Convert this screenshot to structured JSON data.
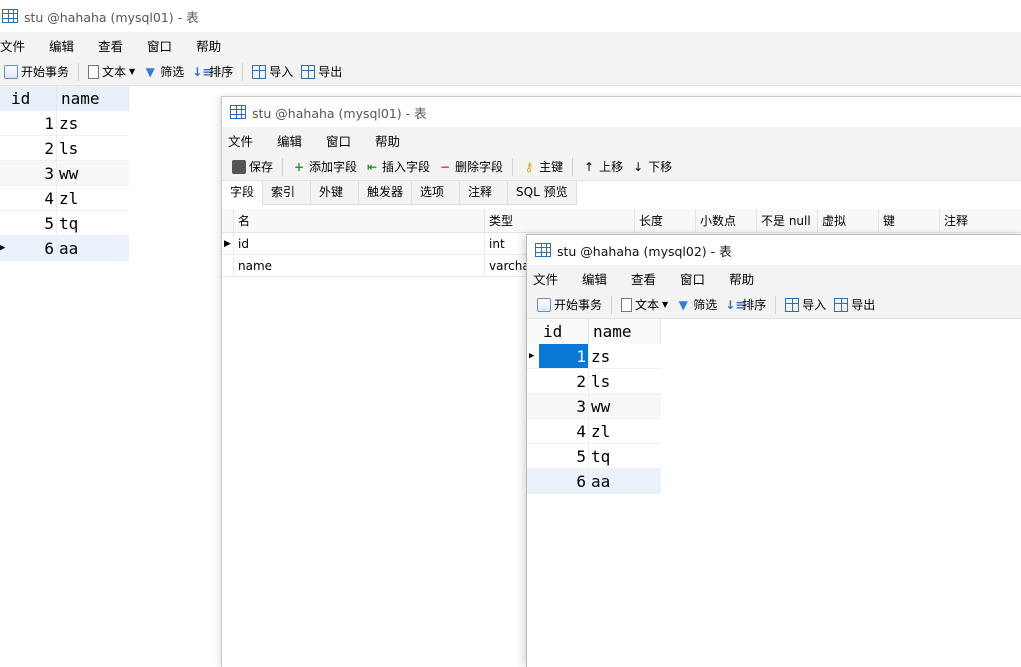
{
  "win1": {
    "title": "stu @hahaha (mysql01) - 表",
    "menu": [
      "文件",
      "编辑",
      "查看",
      "窗口",
      "帮助"
    ],
    "toolbar": {
      "begin_tx": "开始事务",
      "text": "文本",
      "filter": "筛选",
      "sort": "排序",
      "import": "导入",
      "export": "导出"
    },
    "grid": {
      "headers": [
        "id",
        "name"
      ],
      "rows": [
        {
          "id": "1",
          "name": "zs"
        },
        {
          "id": "2",
          "name": "ls"
        },
        {
          "id": "3",
          "name": "ww"
        },
        {
          "id": "4",
          "name": "zl"
        },
        {
          "id": "5",
          "name": "tq"
        },
        {
          "id": "6",
          "name": "aa"
        }
      ]
    }
  },
  "win2": {
    "title": "stu @hahaha (mysql01) - 表",
    "menu": [
      "文件",
      "编辑",
      "窗口",
      "帮助"
    ],
    "toolbar": {
      "save": "保存",
      "add_field": "添加字段",
      "insert_field": "插入字段",
      "delete_field": "删除字段",
      "primary_key": "主键",
      "move_up": "上移",
      "move_down": "下移"
    },
    "tabs": [
      "字段",
      "索引",
      "外键",
      "触发器",
      "选项",
      "注释",
      "SQL 预览"
    ],
    "fields": {
      "headers": [
        "名",
        "类型",
        "长度",
        "小数点",
        "不是 null",
        "虚拟",
        "键",
        "注释"
      ],
      "rows": [
        {
          "name": "id",
          "type": "int"
        },
        {
          "name": "name",
          "type": "varchar"
        }
      ]
    }
  },
  "win3": {
    "title": "stu @hahaha (mysql02) - 表",
    "menu": [
      "文件",
      "编辑",
      "查看",
      "窗口",
      "帮助"
    ],
    "toolbar": {
      "begin_tx": "开始事务",
      "text": "文本",
      "filter": "筛选",
      "sort": "排序",
      "import": "导入",
      "export": "导出"
    },
    "grid": {
      "headers": [
        "id",
        "name"
      ],
      "rows": [
        {
          "id": "1",
          "name": "zs"
        },
        {
          "id": "2",
          "name": "ls"
        },
        {
          "id": "3",
          "name": "ww"
        },
        {
          "id": "4",
          "name": "zl"
        },
        {
          "id": "5",
          "name": "tq"
        },
        {
          "id": "6",
          "name": "aa"
        }
      ]
    }
  }
}
